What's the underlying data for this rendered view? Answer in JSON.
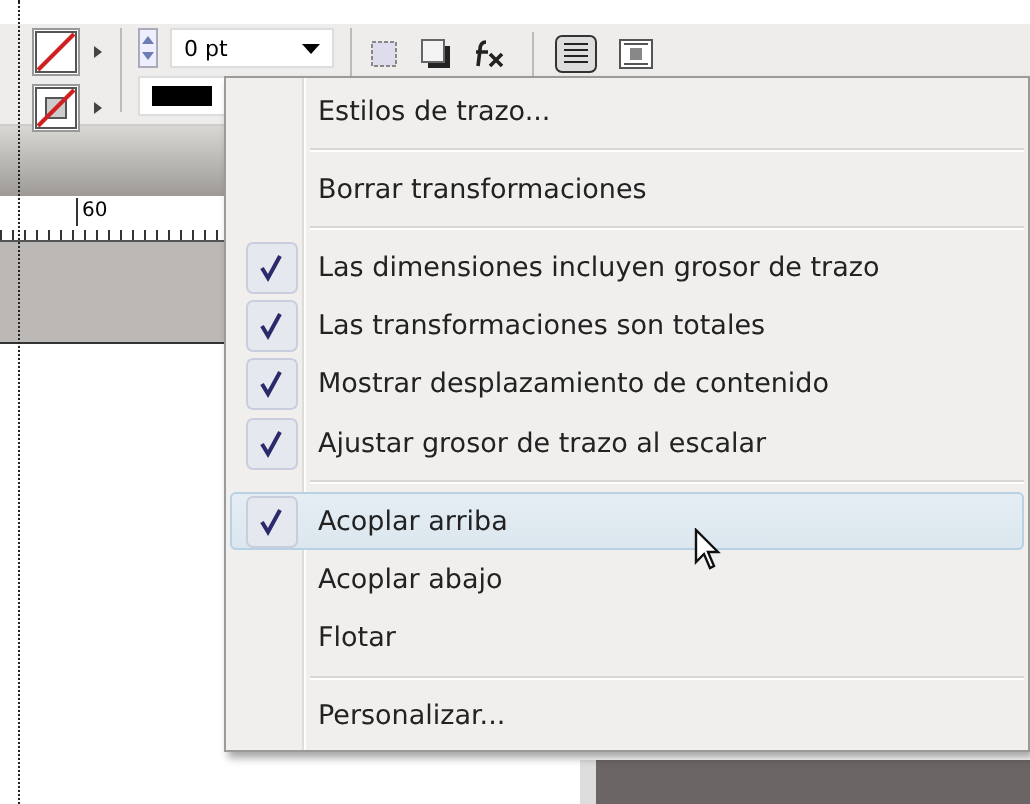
{
  "toolbar": {
    "stroke_weight": {
      "value": "0 pt"
    }
  },
  "ruler": {
    "label": "60"
  },
  "context_menu": {
    "items": [
      {
        "kind": "item",
        "label": "Estilos de trazo...",
        "checked": false,
        "selected": false
      },
      {
        "kind": "separator"
      },
      {
        "kind": "item",
        "label": "Borrar transformaciones",
        "checked": false,
        "selected": false
      },
      {
        "kind": "separator"
      },
      {
        "kind": "item",
        "label": "Las dimensiones incluyen grosor de trazo",
        "checked": true,
        "selected": false
      },
      {
        "kind": "item",
        "label": "Las transformaciones son totales",
        "checked": true,
        "selected": false
      },
      {
        "kind": "item",
        "label": "Mostrar desplazamiento de contenido",
        "checked": true,
        "selected": false
      },
      {
        "kind": "item",
        "label": "Ajustar grosor de trazo al escalar",
        "checked": true,
        "selected": false
      },
      {
        "kind": "separator"
      },
      {
        "kind": "item",
        "label": "Acoplar arriba",
        "checked": true,
        "selected": true
      },
      {
        "kind": "item",
        "label": "Acoplar abajo",
        "checked": false,
        "selected": false
      },
      {
        "kind": "item",
        "label": "Flotar",
        "checked": false,
        "selected": false
      },
      {
        "kind": "separator"
      },
      {
        "kind": "item",
        "label": "Personalizar...",
        "checked": false,
        "selected": false
      }
    ]
  }
}
